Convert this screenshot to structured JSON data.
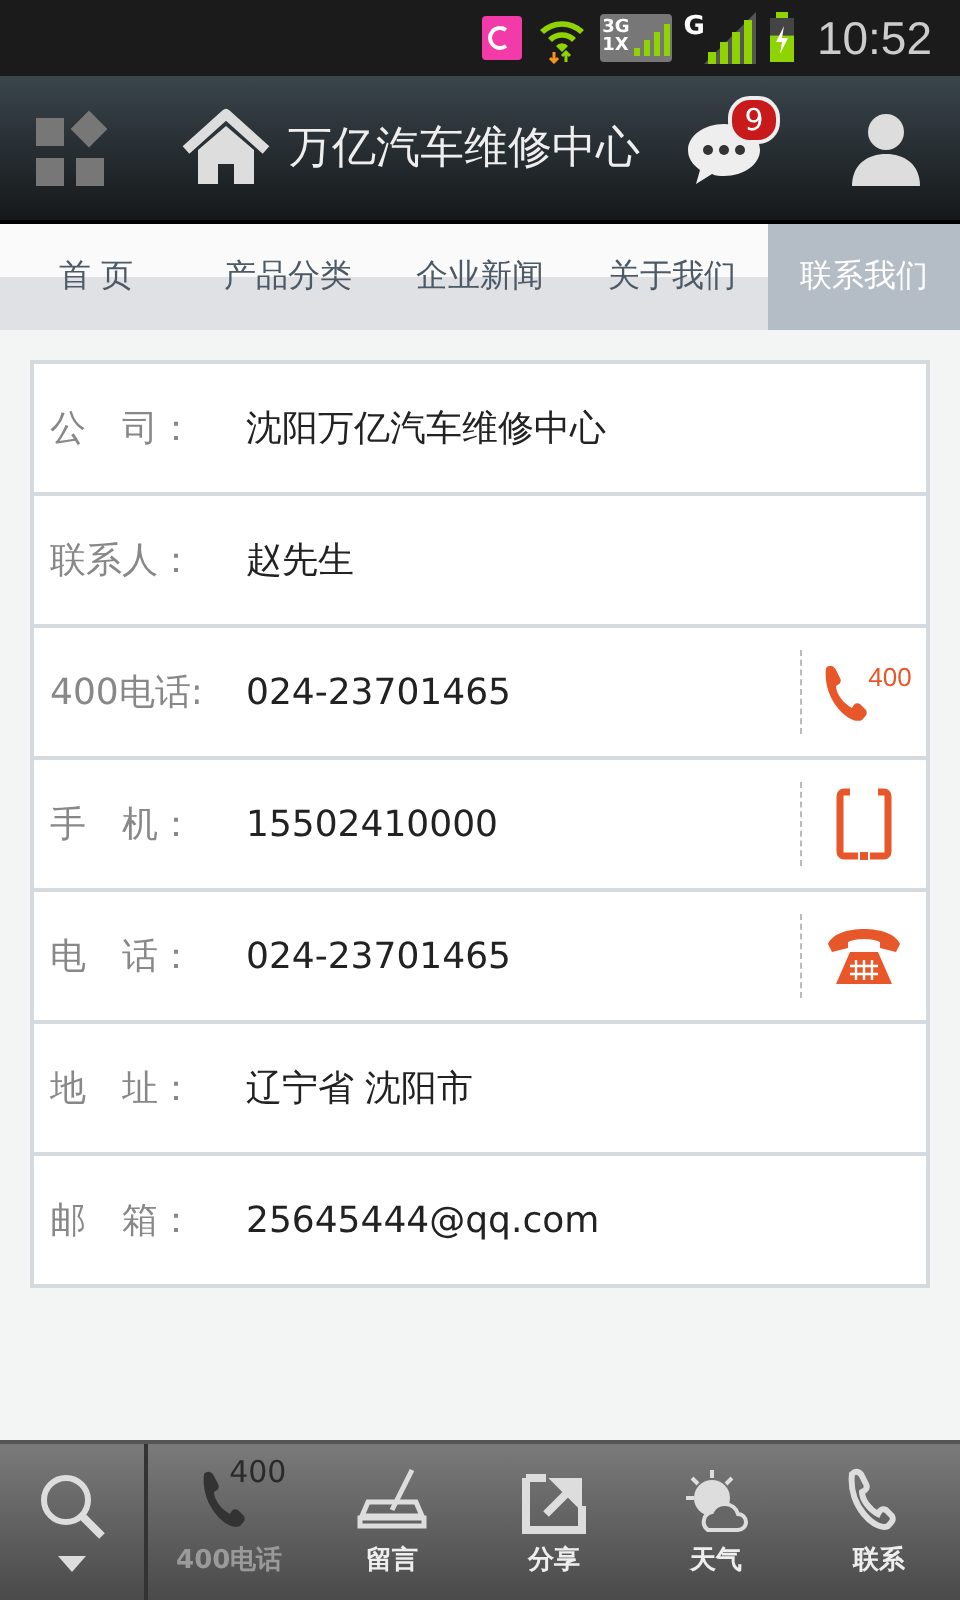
{
  "status_bar": {
    "network_labels": [
      "3G",
      "1X",
      "G"
    ],
    "time": "10:52"
  },
  "header": {
    "title": "万亿汽车维修中心",
    "message_count": "9"
  },
  "tabs": [
    {
      "label": "首 页",
      "selected": false
    },
    {
      "label": "产品分类",
      "selected": false
    },
    {
      "label": "企业新闻",
      "selected": false
    },
    {
      "label": "关于我们",
      "selected": false
    },
    {
      "label": "联系我们",
      "selected": true
    }
  ],
  "contact_rows": [
    {
      "label": "公　司：",
      "value": "沈阳万亿汽车维修中心"
    },
    {
      "label": "联系人：",
      "value": "赵先生"
    },
    {
      "label": "400电话:",
      "value": "024-23701465",
      "action": {
        "kind": "hotline",
        "text": "400"
      }
    },
    {
      "label": "手　机：",
      "value": "15502410000",
      "action": {
        "kind": "mobile"
      }
    },
    {
      "label": "电　话：",
      "value": "024-23701465",
      "action": {
        "kind": "landline"
      }
    },
    {
      "label": "地　址：",
      "value": "辽宁省 沈阳市"
    },
    {
      "label": "邮　箱：",
      "value": "25645444@qq.com"
    }
  ],
  "bottom_bar": [
    {
      "kind": "hotline",
      "icon_text": "400",
      "label": "400电话",
      "disabled": true
    },
    {
      "kind": "message",
      "label": "留言",
      "disabled": false
    },
    {
      "kind": "share",
      "label": "分享",
      "disabled": false
    },
    {
      "kind": "weather",
      "label": "天气",
      "disabled": false
    },
    {
      "kind": "call",
      "label": "联系",
      "disabled": false
    }
  ]
}
